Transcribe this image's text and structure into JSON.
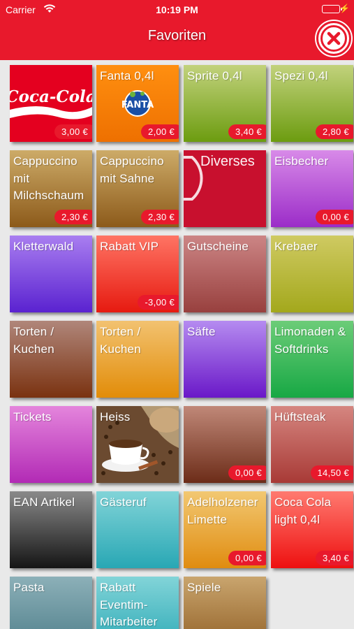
{
  "status_bar": {
    "carrier": "Carrier",
    "time": "10:19 PM",
    "icons": [
      "wifi-icon",
      "battery-icon",
      "charging-bolt-icon"
    ]
  },
  "nav": {
    "title": "Favoriten",
    "close_icon": "close-x-icon"
  },
  "tiles": [
    {
      "label": "",
      "logo": "Coca-Cola",
      "price": "3,00 €"
    },
    {
      "label": "Fanta 0,4l",
      "logo": "FANTA",
      "price": "2,00 €"
    },
    {
      "label": "Sprite 0,4l",
      "price": "3,40 €"
    },
    {
      "label": "Spezi 0,4l",
      "price": "2,80 €"
    },
    {
      "label": "Cappuccino mit Milchschaum",
      "price": "2,30 €"
    },
    {
      "label": "Cappuccino mit Sahne",
      "price": "2,30 €"
    },
    {
      "label": "Diverses",
      "price": ""
    },
    {
      "label": "Eisbecher",
      "price": "0,00 €"
    },
    {
      "label": "Kletterwald",
      "price": ""
    },
    {
      "label": "Rabatt VIP",
      "price": "-3,00 €"
    },
    {
      "label": "Gutscheine",
      "price": ""
    },
    {
      "label": "Krebaer",
      "price": ""
    },
    {
      "label": "Torten / Kuchen",
      "price": ""
    },
    {
      "label": "Torten / Kuchen",
      "price": ""
    },
    {
      "label": "Säfte",
      "price": ""
    },
    {
      "label": "Limonaden & Softdrinks",
      "price": ""
    },
    {
      "label": "Tickets",
      "price": ""
    },
    {
      "label": "Heiss",
      "price": ""
    },
    {
      "label": "",
      "price": "0,00 €"
    },
    {
      "label": "Hüftsteak",
      "price": "14,50 €"
    },
    {
      "label": "EAN Artikel",
      "price": ""
    },
    {
      "label": "Gästeruf",
      "price": ""
    },
    {
      "label": "Adelholzener Limette",
      "price": "0,00 €"
    },
    {
      "label": "Coca Cola light 0,4l",
      "price": "3,40 €"
    },
    {
      "label": "Pasta",
      "price": ""
    },
    {
      "label": "Rabatt Eventim-Mitarbeiter",
      "price": ""
    },
    {
      "label": "Spiele",
      "price": ""
    }
  ],
  "colors": {
    "accent": "#e8192c",
    "background": "#e9e9e9"
  }
}
